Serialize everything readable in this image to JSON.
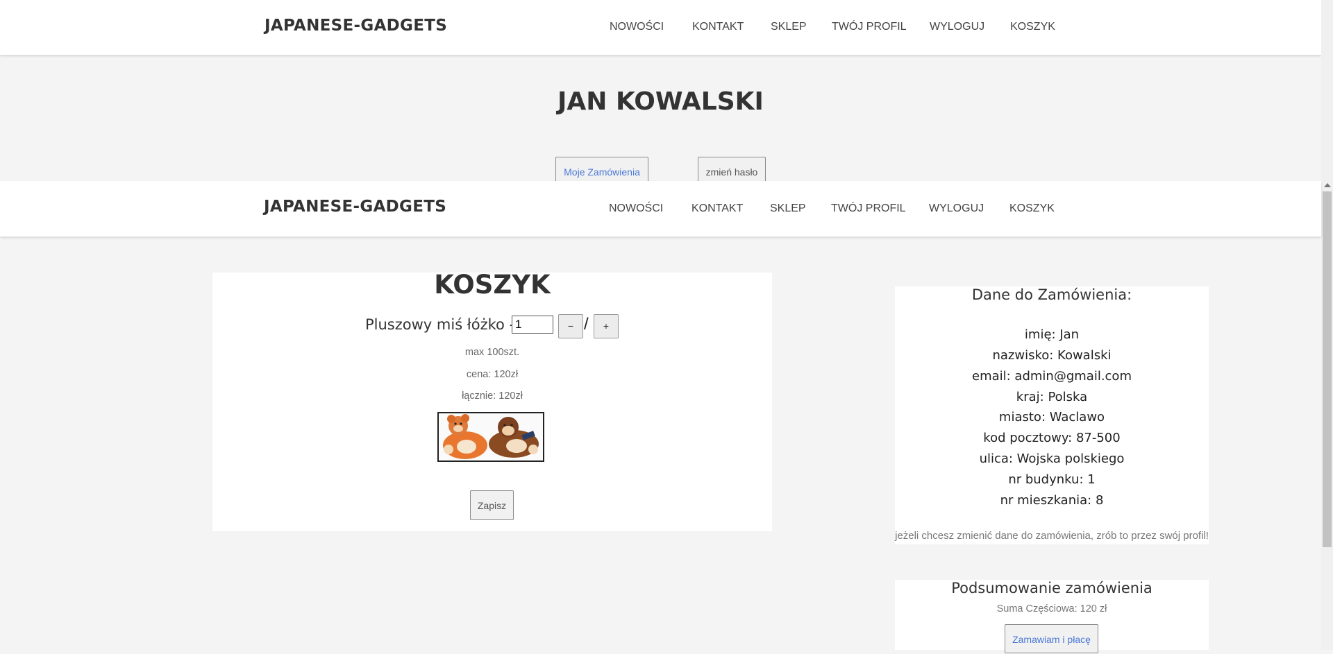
{
  "brand": "JAPANESE-GADGETS",
  "nav": [
    "NOWOŚCI",
    "KONTAKT",
    "SKLEP",
    "TWÓJ PROFIL",
    "WYLOGUJ",
    "KOSZYK"
  ],
  "profile": {
    "name": "JAN KOWALSKI",
    "orders_button": "Moje Zamówienia",
    "password_button": "zmień hasło"
  },
  "cart": {
    "title": "KOSZYK",
    "item": {
      "name": "Pluszowy miś łóżko -",
      "quantity": "1",
      "minus": "−",
      "plus": "+",
      "separator": "/",
      "max": "max 100szt.",
      "price": "cena: 120zł",
      "total": "łącznie: 120zł",
      "image_icon": "plush-teddy-bears-image"
    },
    "save_button": "Zapisz"
  },
  "order_data": {
    "title": "Dane do Zamówienia:",
    "lines": [
      "imię: Jan",
      "nazwisko: Kowalski",
      "email: admin@gmail.com",
      "kraj: Polska",
      "miasto: Waclawo",
      "kod pocztowy: 87-500",
      "ulica: Wojska polskiego",
      "nr budynku: 1",
      "nr mieszkania: 8"
    ],
    "note": "jeżeli chcesz zmienić dane do zamówienia, zrób to przez swój profil!"
  },
  "summary": {
    "title": "Podsumowanie zamówienia",
    "subtotal": "Suma Częściowa: 120 zł",
    "pay_button": "Zamawiam i płacę"
  },
  "colors": {
    "page_bg": "#f4f4f4",
    "panel_bg": "#ffffff",
    "link_blue": "#4a78d6",
    "text_dark": "#333333"
  }
}
